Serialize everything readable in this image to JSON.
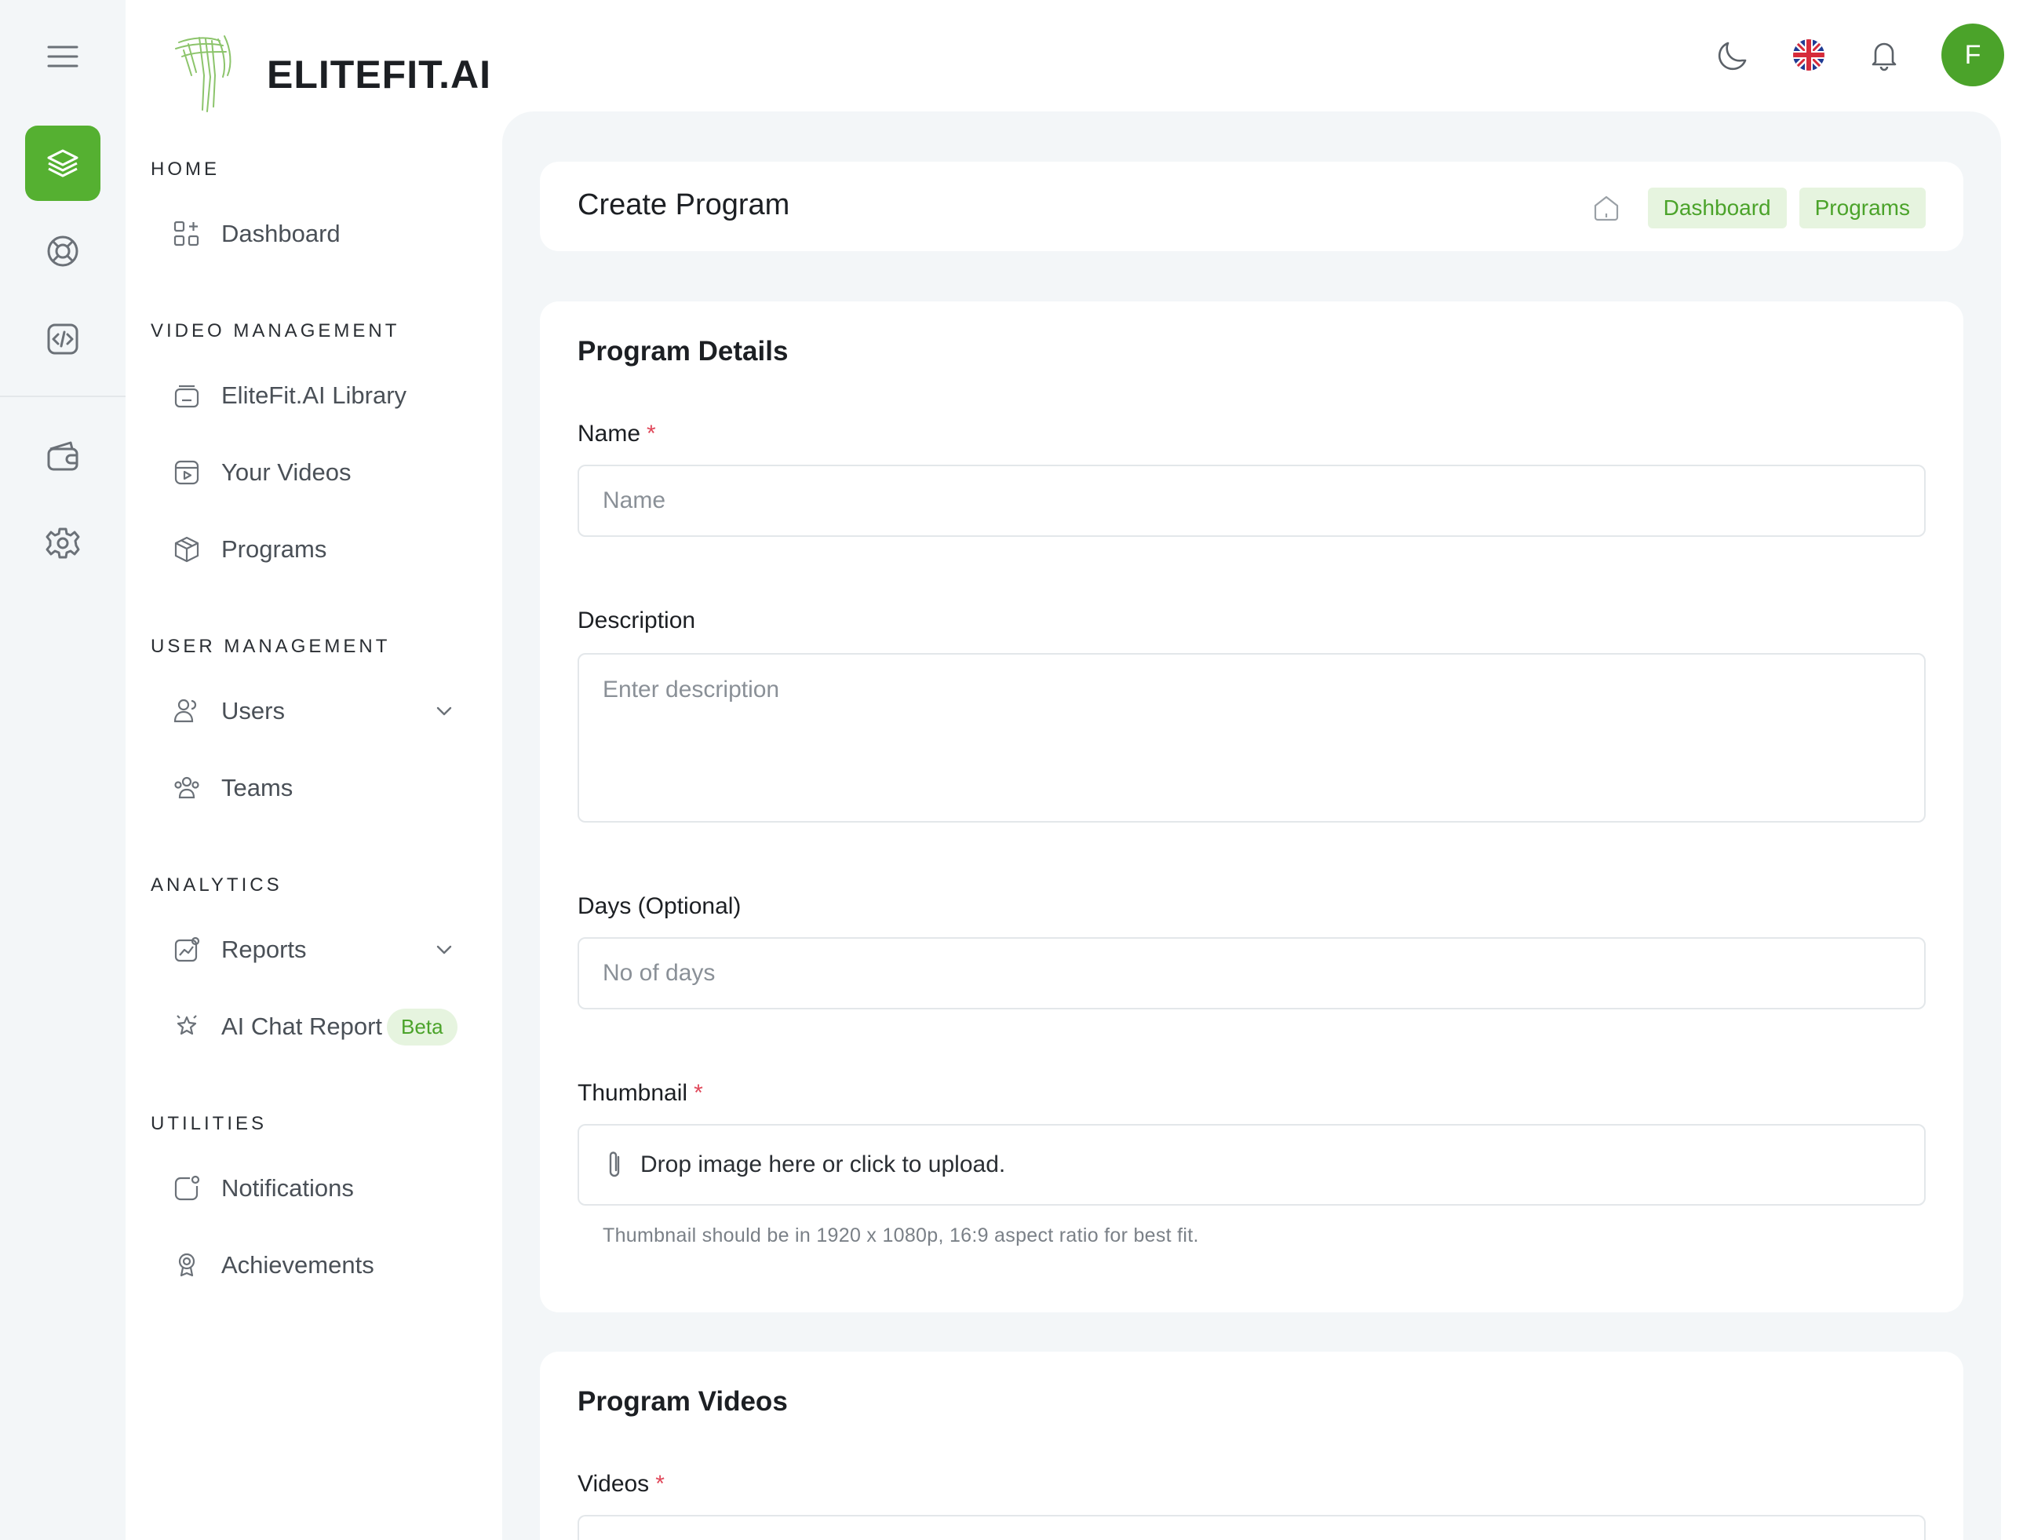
{
  "brand": {
    "name": "ELITEFIT.AI"
  },
  "rail": {
    "menu_icon": "hamburger-menu-icon",
    "items": [
      {
        "icon": "layers-icon",
        "active": true
      },
      {
        "icon": "support-ring-icon",
        "active": false
      },
      {
        "icon": "code-icon",
        "active": false
      },
      {
        "icon": "wallet-icon",
        "active": false
      },
      {
        "icon": "gear-icon",
        "active": false
      }
    ]
  },
  "sidebar": {
    "sections": [
      {
        "title": "HOME",
        "items": [
          {
            "label": "Dashboard",
            "icon": "grid-plus-icon"
          }
        ]
      },
      {
        "title": "VIDEO MANAGEMENT",
        "items": [
          {
            "label": "EliteFit.AI Library",
            "icon": "library-icon"
          },
          {
            "label": "Your Videos",
            "icon": "video-icon"
          },
          {
            "label": "Programs",
            "icon": "box-icon"
          }
        ]
      },
      {
        "title": "USER MANAGEMENT",
        "items": [
          {
            "label": "Users",
            "icon": "users-icon",
            "expandable": true
          },
          {
            "label": "Teams",
            "icon": "teams-icon"
          }
        ]
      },
      {
        "title": "ANALYTICS",
        "items": [
          {
            "label": "Reports",
            "icon": "chart-icon",
            "expandable": true
          },
          {
            "label": "AI Chat Report",
            "icon": "ai-chat-icon",
            "badge": "Beta"
          }
        ]
      },
      {
        "title": "UTILITIES",
        "items": [
          {
            "label": "Notifications",
            "icon": "notification-icon"
          },
          {
            "label": "Achievements",
            "icon": "trophy-icon"
          }
        ]
      }
    ]
  },
  "topbar": {
    "icons": [
      "moon-icon",
      "uk-flag-icon",
      "bell-icon"
    ],
    "avatar_initial": "F"
  },
  "header": {
    "title": "Create Program",
    "breadcrumbs": [
      "Dashboard",
      "Programs"
    ]
  },
  "details": {
    "title": "Program Details",
    "name_label": "Name",
    "name_placeholder": "Name",
    "required_mark": "*",
    "description_label": "Description",
    "description_placeholder": "Enter description",
    "days_label": "Days (Optional)",
    "days_placeholder": "No of days",
    "thumbnail_label": "Thumbnail",
    "thumbnail_upload_text": "Drop image here or click to upload.",
    "thumbnail_hint": "Thumbnail should be in 1920 x 1080p, 16:9 aspect ratio for best fit."
  },
  "videos": {
    "title": "Program Videos",
    "videos_label": "Videos"
  },
  "colors": {
    "accent": "#55b031",
    "accent_text": "#4ba32a",
    "accent_bg": "#e6f4df",
    "required": "#e0485a"
  }
}
